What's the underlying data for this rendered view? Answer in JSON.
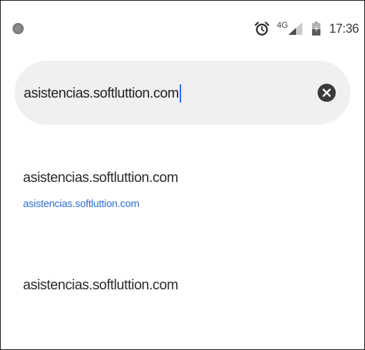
{
  "status_bar": {
    "network_type": "4G",
    "time": "17:36",
    "icons": [
      "notification-dot-icon",
      "alarm-clock-icon",
      "cell-signal-icon",
      "battery-icon"
    ]
  },
  "search": {
    "query": "asistencias.softluttion.com",
    "clear_icon": "close-icon"
  },
  "suggestions": [
    {
      "title": "asistencias.softluttion.com",
      "url": "asistencias.softluttion.com"
    },
    {
      "title": "asistencias.softluttion.com"
    }
  ],
  "colors": {
    "search_background": "#f0f0f0",
    "url_link": "#2f6fd6",
    "text_cursor": "#1a73e8",
    "clear_button": "#3a3a3a"
  }
}
